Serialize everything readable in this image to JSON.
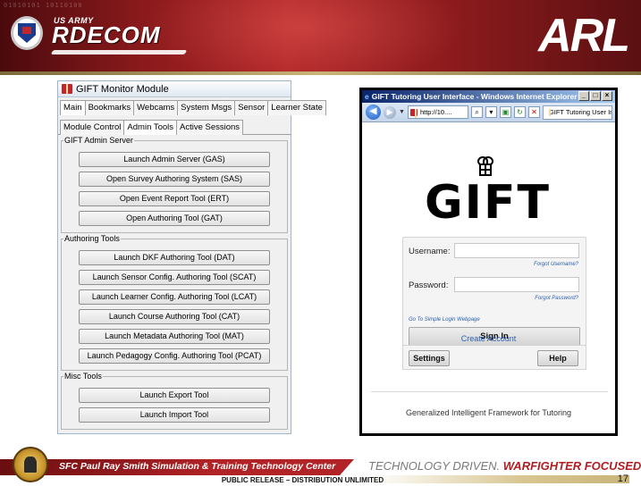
{
  "header": {
    "usarmy": "US ARMY",
    "rdecom": "RDECOM",
    "arl": "ARL",
    "binary": "01010101 10110100"
  },
  "monitor": {
    "title": "GIFT Monitor Module",
    "tabs": [
      "Main",
      "Bookmarks",
      "Webcams",
      "System Msgs",
      "Sensor",
      "Learner State"
    ],
    "subtabs": [
      "Module Control",
      "Admin Tools",
      "Active Sessions"
    ],
    "sections": [
      {
        "label": "GIFT Admin Server",
        "buttons": [
          "Launch Admin Server (GAS)",
          "Open Survey Authoring System (SAS)",
          "Open Event Report Tool (ERT)",
          "Open Authoring Tool (GAT)"
        ]
      },
      {
        "label": "Authoring Tools",
        "buttons": [
          "Launch DKF Authoring Tool (DAT)",
          "Launch Sensor Config. Authoring Tool (SCAT)",
          "Launch Learner Config. Authoring Tool (LCAT)",
          "Launch Course Authoring Tool (CAT)",
          "Launch Metadata Authoring Tool (MAT)",
          "Launch Pedagogy Config. Authoring Tool (PCAT)"
        ]
      },
      {
        "label": "Misc Tools",
        "buttons": [
          "Launch Export Tool",
          "Launch Import Tool"
        ]
      }
    ]
  },
  "browser": {
    "title": "GIFT Tutoring User Interface - Windows Internet Explorer",
    "address": "http://10....",
    "tab": "GIFT Tutoring User Int",
    "logo": "GIFT",
    "username_label": "Username:",
    "forgot_username": "Forgot Username?",
    "password_label": "Password:",
    "forgot_password": "Forgot Password?",
    "simple_login": "Go To Simple Login Webpage",
    "signin": "Sign In",
    "create_account": "Create Account",
    "settings": "Settings",
    "help": "Help",
    "footer": "Generalized Intelligent Framework for Tutoring"
  },
  "footer": {
    "center": "SFC Paul Ray Smith Simulation & Training Technology Center",
    "tagline1": "TECHNOLOGY DRIVEN.",
    "tagline2": "WARFIGHTER FOCUSED.",
    "release": "PUBLIC RELEASE – DISTRIBUTION UNLIMITED",
    "page": "17"
  },
  "colors": {
    "banner_red": "#b02326",
    "link_blue": "#2a5fb0",
    "tagline_red": "#b01e22"
  }
}
